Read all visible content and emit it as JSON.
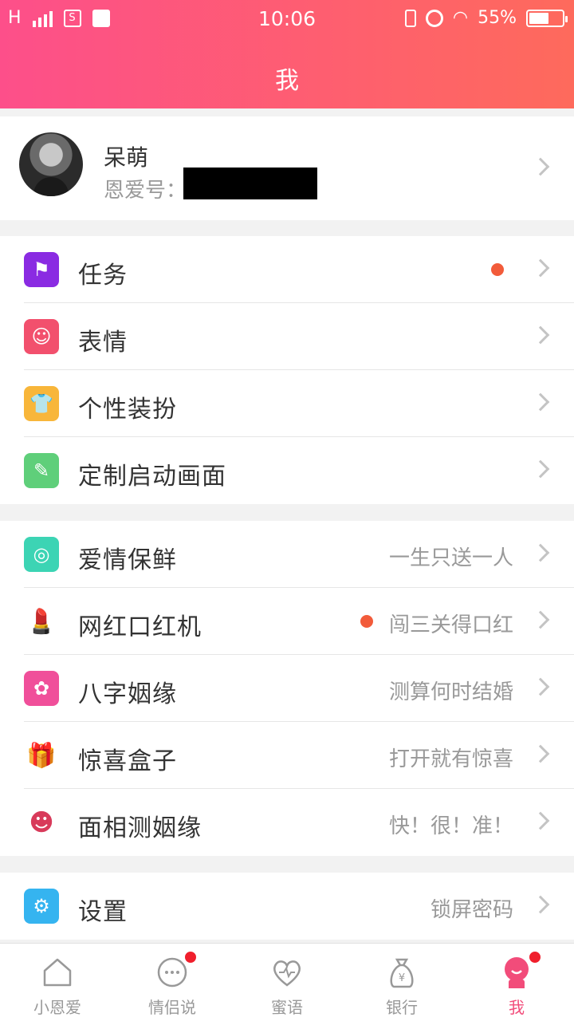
{
  "status_bar": {
    "network": "H",
    "time": "10:06",
    "battery": "55%",
    "battery_level": 0.55
  },
  "header": {
    "title": "我"
  },
  "profile": {
    "name": "呆萌",
    "id_label": "恩爱号："
  },
  "section1": [
    {
      "label": "任务",
      "icon": "flag-icon",
      "color": "#8a2be2",
      "has_dot": true
    },
    {
      "label": "表情",
      "icon": "smiley-icon",
      "color": "#f2506d"
    },
    {
      "label": "个性装扮",
      "icon": "tshirt-icon",
      "color": "#f8b63a"
    },
    {
      "label": "定制启动画面",
      "icon": "brush-icon",
      "color": "#5fcf7a"
    }
  ],
  "section2": [
    {
      "label": "爱情保鲜",
      "hint": "一生只送一人",
      "icon": "lime-icon",
      "color": "#3cd4b4"
    },
    {
      "label": "网红口红机",
      "hint": "闯三关得口红",
      "icon": "lipstick-icon",
      "color": "#ffffff",
      "has_dot": true
    },
    {
      "label": "八字姻缘",
      "hint": "测算何时结婚",
      "icon": "flower-icon",
      "color": "#f04f9a"
    },
    {
      "label": "惊喜盒子",
      "hint": "打开就有惊喜",
      "icon": "gift-icon",
      "color": "#ffffff"
    },
    {
      "label": "面相测姻缘",
      "hint": "快！很！准！",
      "icon": "face-icon",
      "color": "#ffffff"
    }
  ],
  "section3": [
    {
      "label": "设置",
      "hint": "锁屏密码",
      "icon": "gear-icon",
      "color": "#35b4f0"
    }
  ],
  "tabs": [
    {
      "label": "小恩爱",
      "icon": "home-icon"
    },
    {
      "label": "情侣说",
      "icon": "chat-icon",
      "badge": true
    },
    {
      "label": "蜜语",
      "icon": "heart-pulse-icon"
    },
    {
      "label": "银行",
      "icon": "money-bag-icon"
    },
    {
      "label": "我",
      "icon": "me-icon",
      "badge": true,
      "active": true
    }
  ],
  "colors": {
    "header_start": "#fd4f8a",
    "header_end": "#fe6a5c",
    "accent": "#f24c7a",
    "dot": "#f25b3a"
  }
}
